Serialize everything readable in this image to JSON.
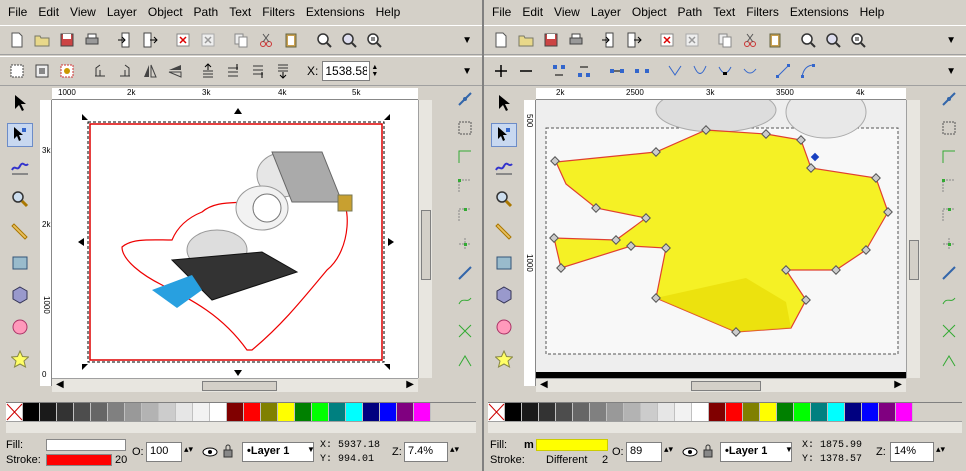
{
  "menu": [
    "File",
    "Edit",
    "View",
    "Layer",
    "Object",
    "Path",
    "Text",
    "Filters",
    "Extensions",
    "Help"
  ],
  "left": {
    "x_label": "X:",
    "x_value": "1538.58",
    "hruler_ticks": [
      "1000",
      "2k",
      "3k",
      "4k",
      "5k"
    ],
    "vruler_ticks": [
      "3k",
      "2k",
      "1000",
      "0"
    ],
    "status": {
      "fill_label": "Fill:",
      "stroke_label": "Stroke:",
      "fill_color": "#ffffff",
      "stroke_color": "#ff0000",
      "stroke_width": "20",
      "opacity_label": "O:",
      "opacity": "100",
      "layer": "•Layer 1",
      "x": "X: 5937.18",
      "y": "Y:  994.01",
      "zoom_label": "Z:",
      "zoom": "7.4%"
    }
  },
  "right": {
    "hruler_ticks": [
      "2k",
      "2500",
      "3k",
      "3500",
      "4k"
    ],
    "vruler_ticks": [
      "1000",
      "500"
    ],
    "status": {
      "fill_label": "Fill:",
      "stroke_label": "Stroke:",
      "fill_mode": "m",
      "fill_color": "#ffff00",
      "stroke_text": "Different",
      "stroke_width": "2",
      "opacity_label": "O:",
      "opacity": "89",
      "layer": "•Layer 1",
      "x": "X: 1875.99",
      "y": "Y: 1378.57",
      "zoom_label": "Z:",
      "zoom": "14%"
    }
  },
  "palette": [
    "#000000",
    "#1a1a1a",
    "#333333",
    "#4d4d4d",
    "#666666",
    "#808080",
    "#999999",
    "#b3b3b3",
    "#cccccc",
    "#e6e6e6",
    "#f2f2f2",
    "#ffffff",
    "#800000",
    "#ff0000",
    "#808000",
    "#ffff00",
    "#008000",
    "#00ff00",
    "#008080",
    "#00ffff",
    "#000080",
    "#0000ff",
    "#800080",
    "#ff00ff"
  ]
}
